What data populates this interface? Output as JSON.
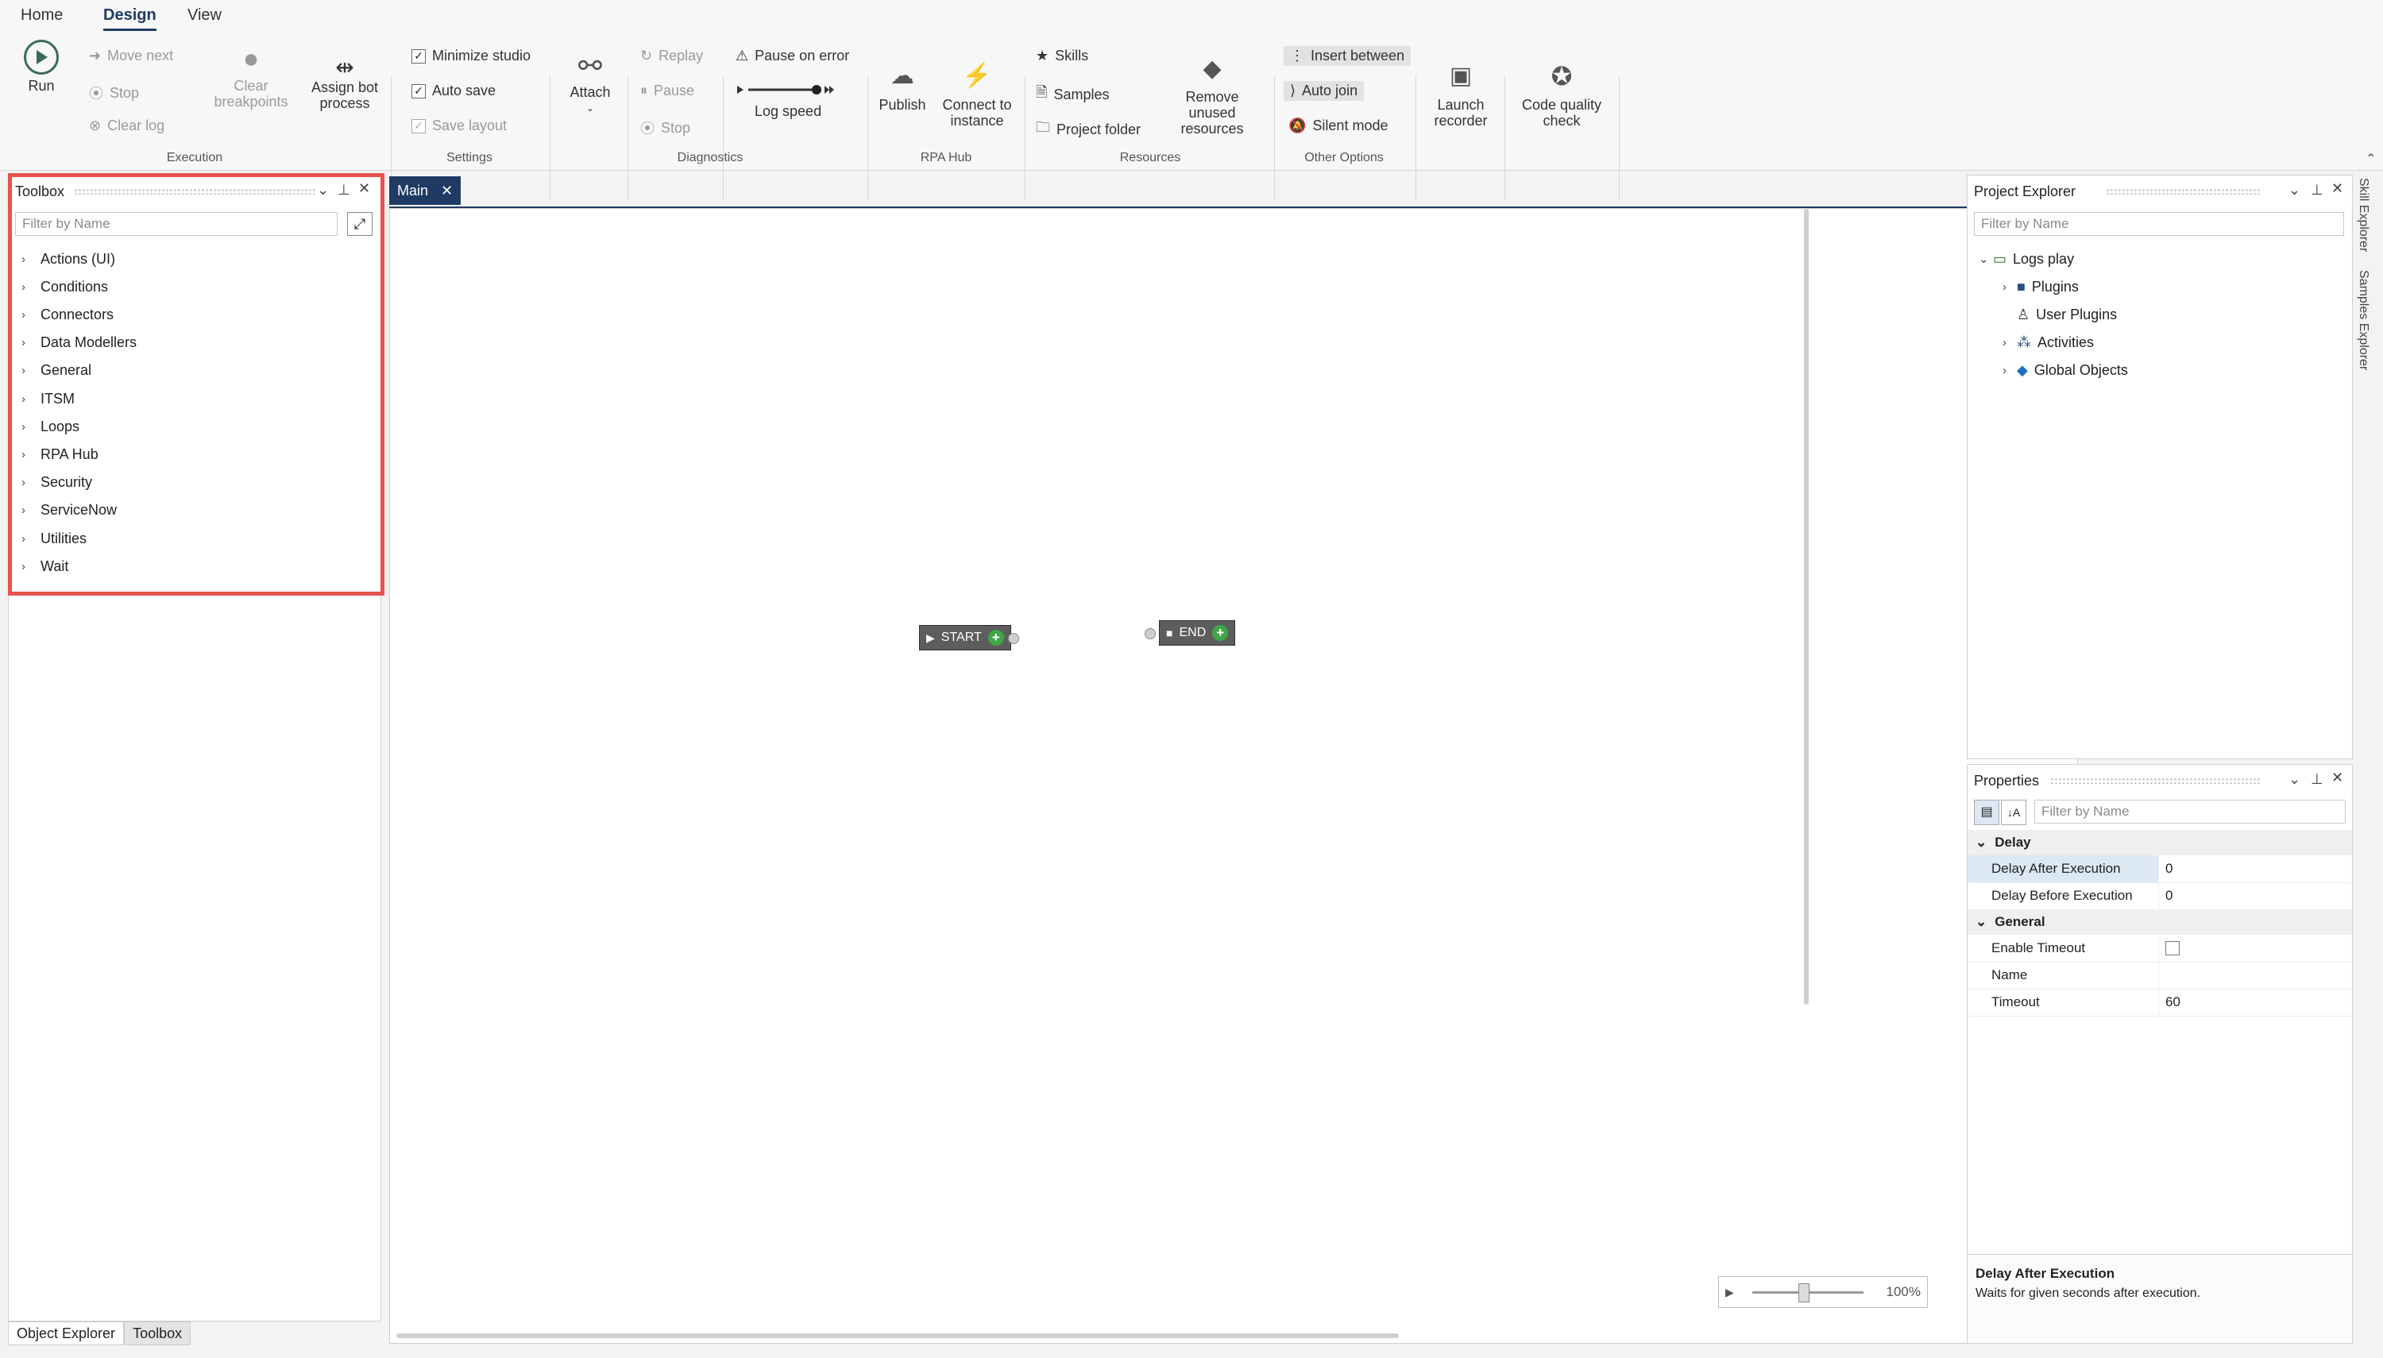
{
  "menu": {
    "tabs": [
      "Home",
      "Design",
      "View"
    ]
  },
  "ribbon": {
    "execution": {
      "run": "Run",
      "move_next": "Move next",
      "stop": "Stop",
      "clear_log": "Clear log",
      "clear_breakpoints": "Clear breakpoints",
      "assign_bot": "Assign bot process",
      "group": "Execution"
    },
    "settings": {
      "minimize_studio": "Minimize studio",
      "auto_save": "Auto save",
      "save_layout": "Save layout",
      "group": "Settings"
    },
    "diagnostics": {
      "attach": "Attach",
      "replay": "Replay",
      "pause": "Pause",
      "stop": "Stop",
      "pause_on_error": "Pause on error",
      "log_speed": "Log speed",
      "group": "Diagnostics"
    },
    "rpa_hub": {
      "publish": "Publish",
      "connect": "Connect to instance",
      "group": "RPA Hub"
    },
    "resources": {
      "skills": "Skills",
      "samples": "Samples",
      "project_folder": "Project folder",
      "remove_unused": "Remove unused resources",
      "group": "Resources"
    },
    "other": {
      "insert_between": "Insert between",
      "auto_join": "Auto join",
      "silent_mode": "Silent mode",
      "group": "Other Options"
    },
    "launch_recorder": "Launch recorder",
    "code_quality": "Code quality check"
  },
  "toolbox": {
    "title": "Toolbox",
    "filter_placeholder": "Filter by Name",
    "items": [
      "Actions (UI)",
      "Conditions",
      "Connectors",
      "Data Modellers",
      "General",
      "ITSM",
      "Loops",
      "RPA Hub",
      "Security",
      "ServiceNow",
      "Utilities",
      "Wait"
    ]
  },
  "bottom_tabs": [
    "Object Explorer",
    "Toolbox"
  ],
  "canvas": {
    "tab": "Main",
    "start_label": "START",
    "end_label": "END",
    "zoom": "100%"
  },
  "project_explorer": {
    "title": "Project Explorer",
    "filter_placeholder": "Filter by Name",
    "root": "Logs play",
    "children": [
      "Plugins",
      "User Plugins",
      "Activities",
      "Global Objects"
    ]
  },
  "side_tabs": [
    "Skill Explorer",
    "Samples Explorer"
  ],
  "properties": {
    "title": "Properties",
    "filter_placeholder": "Filter by Name",
    "categories": [
      {
        "name": "Delay",
        "rows": [
          {
            "name": "Delay After Execution",
            "value": "0"
          },
          {
            "name": "Delay Before Execution",
            "value": "0"
          }
        ]
      },
      {
        "name": "General",
        "rows": [
          {
            "name": "Enable Timeout",
            "value": ""
          },
          {
            "name": "Name",
            "value": ""
          },
          {
            "name": "Timeout",
            "value": "60"
          }
        ]
      }
    ],
    "description_title": "Delay After Execution",
    "description_text": "Waits for given seconds after execution."
  },
  "highlight_color": "#e8534f"
}
